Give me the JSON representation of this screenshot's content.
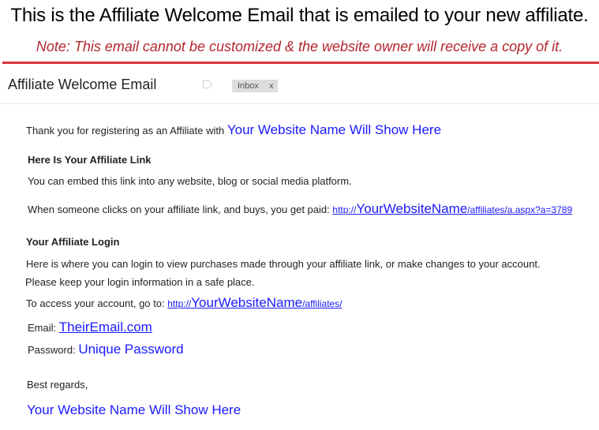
{
  "banner": {
    "headline": "This is the Affiliate Welcome Email that is emailed to your new affiliate",
    "headline_end": ".",
    "note": "Note: This email cannot be customized & the website owner will receive a copy of it."
  },
  "email": {
    "subject": "Affiliate Welcome Email",
    "label_chip": {
      "text": "Inbox",
      "close": "x"
    },
    "greeting_prefix": "Thank you for registering as an Affiliate with",
    "site_name": "Your Website Name Will Show Here",
    "link_section": {
      "heading": "Here Is Your Affiliate Link",
      "embed_text": "You can embed this link into any website, blog or social media platform.",
      "paid_text": "When someone clicks on your affiliate link, and buys, you get paid:",
      "url_prefix": "http://",
      "url_site": "YourWebsiteName",
      "url_path": "/affiliates/a.aspx?a=3789"
    },
    "login_section": {
      "heading": "Your Affiliate Login",
      "line1": "Here is where you can login to view purchases made through your affiliate link, or make changes to your account.",
      "line2": "Please keep your login information in a safe place.",
      "access_text": "To access your account, go to:",
      "url_prefix": "http://",
      "url_site": "YourWebsiteName",
      "url_path": "/affiliates/",
      "email_label": "Email:",
      "email_value": "TheirEmail.com",
      "password_label": "Password:",
      "password_value": "Unique Password"
    },
    "closing": "Best regards,",
    "signature": "Your Website Name Will Show Here"
  },
  "colors": {
    "note_red": "#b3262d",
    "rule_red": "#d9363e",
    "link_blue": "#1a1aff"
  }
}
